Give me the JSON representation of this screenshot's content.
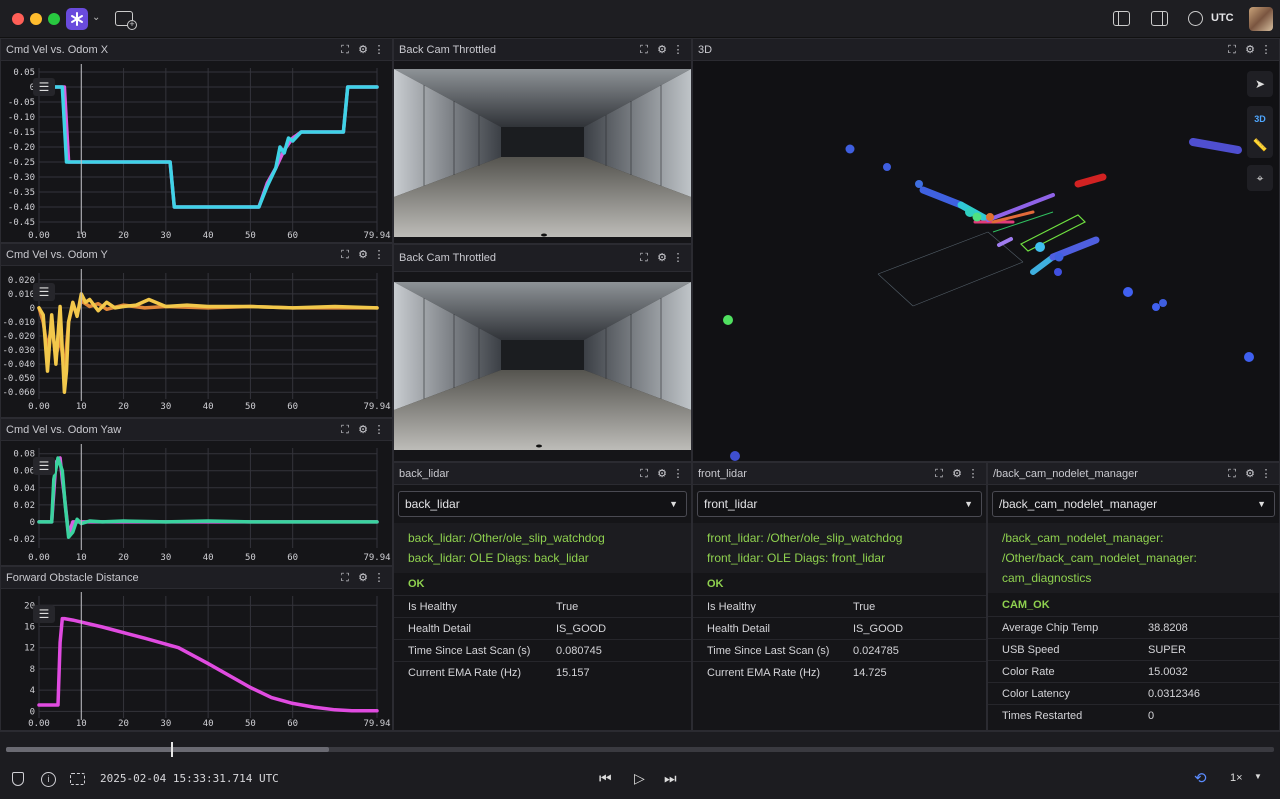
{
  "toolbar": {
    "timezone": "UTC"
  },
  "panels": {
    "odom_x": {
      "title": "Cmd Vel vs. Odom X"
    },
    "odom_y": {
      "title": "Cmd Vel vs. Odom Y"
    },
    "odom_yaw": {
      "title": "Cmd Vel vs. Odom Yaw"
    },
    "obstacle": {
      "title": "Forward Obstacle Distance"
    },
    "cam1": {
      "title": "Back Cam Throttled"
    },
    "cam2": {
      "title": "Back Cam Throttled"
    },
    "three_d": {
      "title": "3D",
      "mode_label": "3D"
    },
    "back_lidar": {
      "title": "back_lidar",
      "select": "back_lidar",
      "header_lines": [
        "back_lidar: /Other/ole_slip_watchdog",
        "back_lidar: OLE Diags: back_lidar"
      ],
      "status": "OK",
      "rows": [
        {
          "k": "Is Healthy",
          "v": "True"
        },
        {
          "k": "Health Detail",
          "v": "IS_GOOD"
        },
        {
          "k": "Time Since Last Scan (s)",
          "v": "0.080745"
        },
        {
          "k": "Current EMA Rate (Hz)",
          "v": "15.157"
        }
      ]
    },
    "front_lidar": {
      "title": "front_lidar",
      "select": "front_lidar",
      "header_lines": [
        "front_lidar: /Other/ole_slip_watchdog",
        "front_lidar: OLE Diags: front_lidar"
      ],
      "status": "OK",
      "rows": [
        {
          "k": "Is Healthy",
          "v": "True"
        },
        {
          "k": "Health Detail",
          "v": "IS_GOOD"
        },
        {
          "k": "Time Since Last Scan (s)",
          "v": "0.024785"
        },
        {
          "k": "Current EMA Rate (Hz)",
          "v": "14.725"
        }
      ]
    },
    "cam_mgr": {
      "title": "/back_cam_nodelet_manager",
      "select": "/back_cam_nodelet_manager",
      "header_lines": [
        "/back_cam_nodelet_manager:",
        "/Other/back_cam_nodelet_manager:",
        "cam_diagnostics"
      ],
      "status": "CAM_OK",
      "rows": [
        {
          "k": "Average Chip Temp",
          "v": "38.8208"
        },
        {
          "k": "USB Speed",
          "v": "SUPER"
        },
        {
          "k": "Color Rate",
          "v": "15.0032"
        },
        {
          "k": "Color Latency",
          "v": "0.0312346"
        },
        {
          "k": "Times Restarted",
          "v": "0"
        }
      ]
    }
  },
  "playback": {
    "timestamp": "2025-02-04 15:33:31.714 UTC",
    "speed": "1×",
    "progress": 0.255
  },
  "chart_data": [
    {
      "type": "line",
      "title": "Cmd Vel vs. Odom X",
      "x_ticks": [
        "0.00",
        "10",
        "20",
        "30",
        "40",
        "50",
        "60",
        "79.94"
      ],
      "y_ticks": [
        "0.05",
        "0",
        "-0.05",
        "-0.10",
        "-0.15",
        "-0.20",
        "-0.25",
        "-0.30",
        "-0.35",
        "-0.40",
        "-0.45"
      ],
      "xlim": [
        0,
        79.94
      ],
      "ylim": [
        -0.47,
        0.05
      ],
      "cursor_x": 10,
      "series": [
        {
          "color": "#d95fe0",
          "x": [
            0,
            3,
            6,
            7,
            31,
            32,
            52,
            54,
            56,
            58,
            60,
            62,
            66,
            72,
            73,
            79.94
          ],
          "y": [
            0,
            0,
            0,
            -0.25,
            -0.25,
            -0.4,
            -0.4,
            -0.32,
            -0.27,
            -0.21,
            -0.17,
            -0.15,
            -0.15,
            -0.15,
            0,
            0
          ]
        },
        {
          "color": "#3fd3e6",
          "x": [
            0,
            3,
            5.5,
            6.5,
            31,
            32,
            52,
            54,
            56,
            57,
            58,
            59,
            60,
            62,
            66,
            72,
            73,
            79.94
          ],
          "y": [
            0,
            0,
            0,
            -0.25,
            -0.25,
            -0.4,
            -0.4,
            -0.33,
            -0.27,
            -0.2,
            -0.22,
            -0.17,
            -0.18,
            -0.15,
            -0.15,
            -0.15,
            0,
            0
          ]
        }
      ]
    },
    {
      "type": "line",
      "title": "Cmd Vel vs. Odom Y",
      "x_ticks": [
        "0.00",
        "10",
        "20",
        "30",
        "40",
        "50",
        "60",
        "79.94"
      ],
      "y_ticks": [
        "0.020",
        "0.010",
        "0",
        "-0.010",
        "-0.020",
        "-0.030",
        "-0.040",
        "-0.050",
        "-0.060"
      ],
      "xlim": [
        0,
        79.94
      ],
      "ylim": [
        -0.062,
        0.022
      ],
      "cursor_x": 10,
      "series": [
        {
          "color": "#e0873a",
          "x": [
            0,
            1,
            2,
            3,
            4,
            5,
            6,
            7,
            8,
            9,
            10,
            12,
            14,
            16,
            20,
            25,
            30,
            40,
            50,
            60,
            70,
            79.94
          ],
          "y": [
            0,
            -0.01,
            -0.03,
            -0.012,
            -0.035,
            -0.02,
            -0.045,
            -0.01,
            0.002,
            -0.004,
            0.005,
            0.001,
            0.003,
            -0.001,
            0.002,
            0,
            0.001,
            0,
            0.001,
            0,
            0,
            0
          ]
        },
        {
          "color": "#f2c84b",
          "x": [
            0,
            1,
            2,
            3,
            4,
            5,
            6,
            6.5,
            7,
            8,
            9,
            10,
            11,
            12,
            14,
            16,
            18,
            20,
            23,
            26,
            30,
            35,
            40,
            50,
            60,
            70,
            79.94
          ],
          "y": [
            0,
            -0.005,
            -0.045,
            -0.005,
            -0.04,
            0.001,
            -0.06,
            -0.045,
            -0.01,
            0.004,
            -0.006,
            0.01,
            0.004,
            0.006,
            -0.002,
            0.004,
            0,
            0.001,
            0.002,
            0.006,
            0.001,
            0.002,
            0.001,
            0.001,
            0,
            0.001,
            0
          ]
        }
      ]
    },
    {
      "type": "line",
      "title": "Cmd Vel vs. Odom Yaw",
      "x_ticks": [
        "0.00",
        "10",
        "20",
        "30",
        "40",
        "50",
        "60",
        "79.94"
      ],
      "y_ticks": [
        "0.08",
        "0.06",
        "0.04",
        "0.02",
        "0",
        "-0.02"
      ],
      "xlim": [
        0,
        79.94
      ],
      "ylim": [
        -0.026,
        0.082
      ],
      "cursor_x": 10,
      "series": [
        {
          "color": "#d95fe0",
          "x": [
            0,
            3,
            4,
            5,
            5.5,
            6,
            7,
            8,
            9,
            79.94
          ],
          "y": [
            0,
            0,
            0.07,
            0.075,
            0.05,
            0.03,
            -0.015,
            0,
            0,
            0
          ]
        },
        {
          "color": "#3bd39f",
          "x": [
            0,
            3,
            3.5,
            4.5,
            5.5,
            6.2,
            7,
            8,
            9,
            10,
            12,
            15,
            20,
            30,
            40,
            50,
            60,
            70,
            79.94
          ],
          "y": [
            0,
            0,
            0.05,
            0.075,
            0.06,
            0.02,
            -0.018,
            -0.012,
            0.003,
            -0.002,
            0.001,
            0,
            0.001,
            0,
            0.001,
            0,
            0,
            0,
            0
          ]
        }
      ]
    },
    {
      "type": "line",
      "title": "Forward Obstacle Distance",
      "x_ticks": [
        "0.00",
        "10",
        "20",
        "30",
        "40",
        "50",
        "60",
        "79.94"
      ],
      "y_ticks": [
        "20",
        "16",
        "12",
        "8",
        "4",
        "0"
      ],
      "xlim": [
        0,
        79.94
      ],
      "ylim": [
        -0.5,
        21
      ],
      "cursor_x": 10,
      "series": [
        {
          "color": "#e04be0",
          "x": [
            0,
            4.5,
            5,
            5.5,
            6,
            8,
            15,
            25,
            33,
            40,
            50,
            55,
            60,
            65,
            70,
            74,
            79.94
          ],
          "y": [
            1.2,
            1.2,
            13,
            17.5,
            17.5,
            17.2,
            15.9,
            13.8,
            12,
            9,
            4.5,
            2.6,
            1.5,
            0.8,
            0.3,
            0.1,
            0.1
          ]
        }
      ]
    }
  ]
}
